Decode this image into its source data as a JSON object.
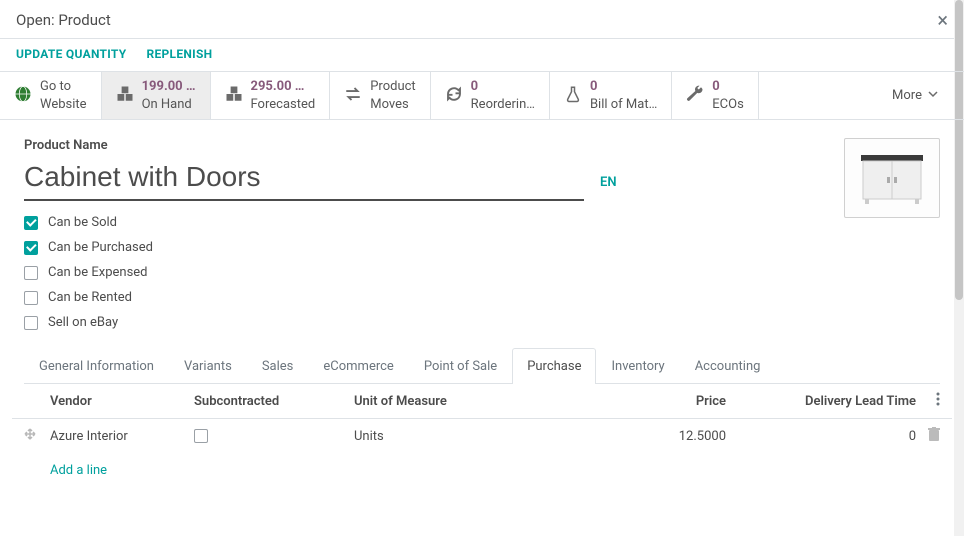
{
  "header": {
    "title": "Open: Product",
    "close_symbol": "×"
  },
  "actions": {
    "update_qty": "UPDATE QUANTITY",
    "replenish": "REPLENISH"
  },
  "stats": {
    "website_line1": "Go to",
    "website_line2": "Website",
    "onhand_value": "199.00 …",
    "onhand_label": "On Hand",
    "forecast_value": "295.00 …",
    "forecast_label": "Forecasted",
    "moves_line1": "Product",
    "moves_line2": "Moves",
    "reorder_value": "0",
    "reorder_label": "Reorderin…",
    "bom_value": "0",
    "bom_label": "Bill of Mat…",
    "eco_value": "0",
    "eco_label": "ECOs",
    "more_label": "More"
  },
  "form": {
    "name_label": "Product Name",
    "name_value": "Cabinet with Doors",
    "lang": "EN"
  },
  "checkboxes": {
    "sold": "Can be Sold",
    "purchased": "Can be Purchased",
    "expensed": "Can be Expensed",
    "rented": "Can be Rented",
    "ebay": "Sell on eBay"
  },
  "tabs": {
    "general": "General Information",
    "variants": "Variants",
    "sales": "Sales",
    "ecommerce": "eCommerce",
    "pos": "Point of Sale",
    "purchase": "Purchase",
    "inventory": "Inventory",
    "accounting": "Accounting"
  },
  "grid": {
    "headers": {
      "vendor": "Vendor",
      "subcontracted": "Subcontracted",
      "uom": "Unit of Measure",
      "price": "Price",
      "lead": "Delivery Lead Time"
    },
    "rows": [
      {
        "vendor": "Azure Interior",
        "subcontracted": false,
        "uom": "Units",
        "price": "12.5000",
        "lead": "0"
      }
    ],
    "add_line": "Add a line"
  }
}
